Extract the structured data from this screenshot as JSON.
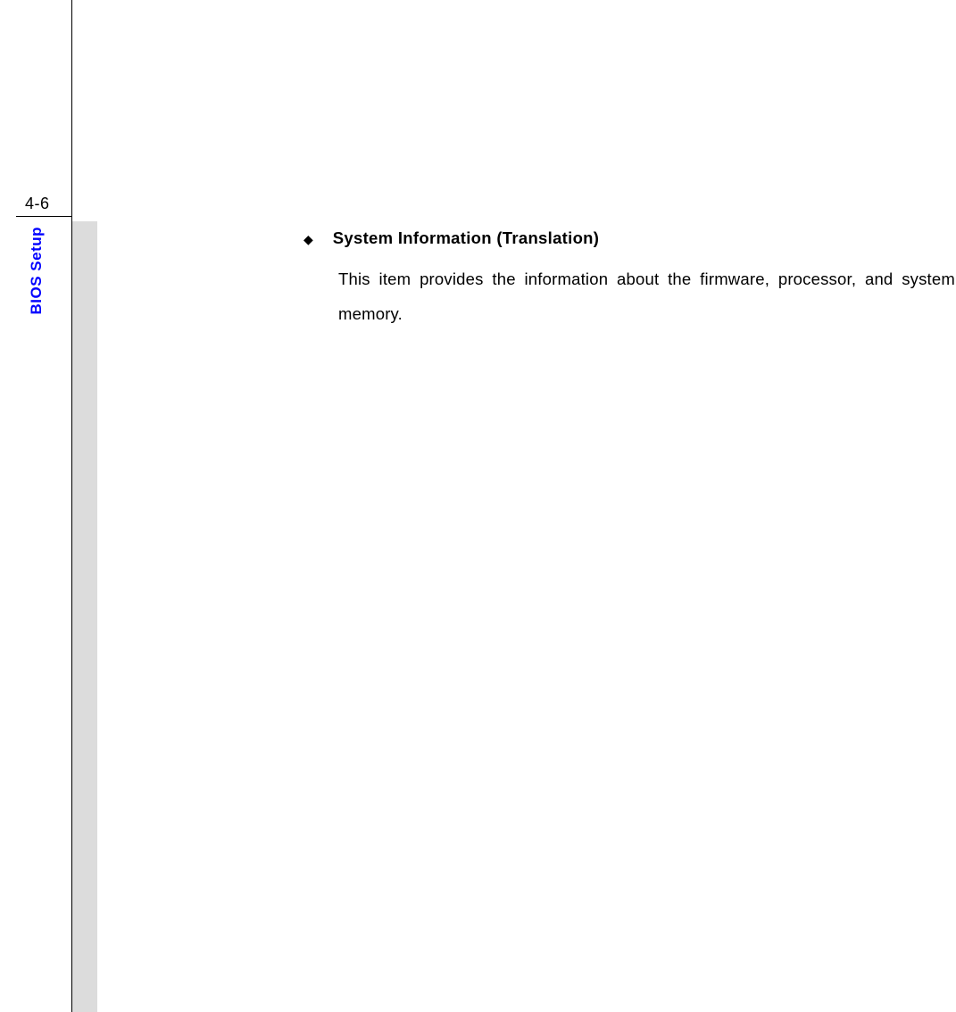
{
  "page": {
    "number": "4-6",
    "section_label": "BIOS Setup"
  },
  "content": {
    "bullet_glyph": "◆",
    "item_title": "System Information (Translation)",
    "item_description": "This item provides the information about the firmware, processor, and system memory."
  }
}
